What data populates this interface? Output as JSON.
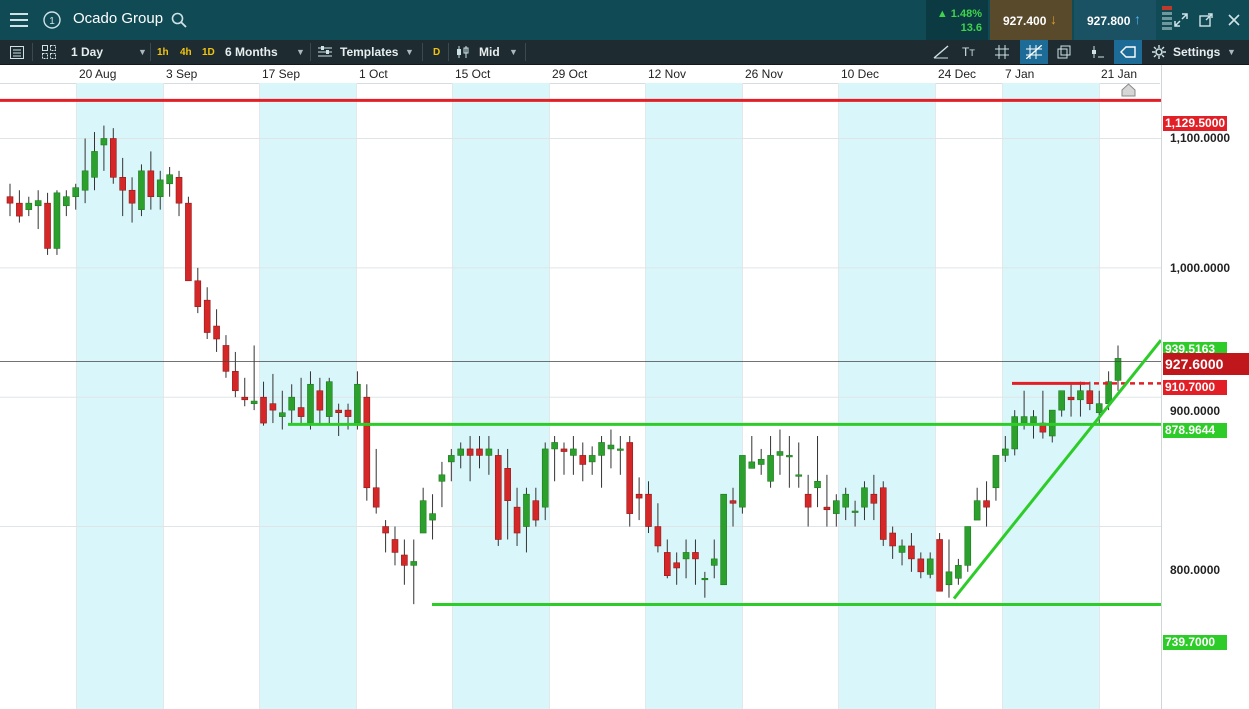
{
  "header": {
    "menu_icon": "hamburger-icon",
    "info_icon": "info-circle-icon",
    "title": "Ocado Group",
    "search_icon": "search-icon",
    "change_pct": "1.48%",
    "change_abs": "13.6",
    "sell_price": "927.400",
    "buy_price": "927.800",
    "colors": {
      "up": "#3fd44a",
      "bar": "#0f4a55"
    }
  },
  "toolbar": {
    "interval": "1 Day",
    "tf_1h": "1h",
    "tf_4h": "4h",
    "tf_1d": "1D",
    "range": "6 Months",
    "templates": "Templates",
    "d_badge": "D",
    "price_type": "Mid",
    "settings": "Settings"
  },
  "xaxis": {
    "labels": [
      "20 Aug",
      "3 Sep",
      "17 Sep",
      "1 Oct",
      "15 Oct",
      "29 Oct",
      "12 Nov",
      "26 Nov",
      "10 Dec",
      "24 Dec",
      "7 Jan",
      "21 Jan"
    ]
  },
  "yaxis": {
    "labels": [
      "1,100.0000",
      "1,000.0000",
      "900.0000",
      "800.0000"
    ]
  },
  "price_tags": {
    "resistance_red": "1,129.5000",
    "green_top": "939.5163",
    "current": "927.6000",
    "red_dashed": "910.7000",
    "support_mid": "878.9644",
    "support_low": "739.7000"
  },
  "chart_data": {
    "type": "candlestick",
    "ylim": [
      710,
      1160
    ],
    "x_labels": [
      "20 Aug",
      "3 Sep",
      "17 Sep",
      "1 Oct",
      "15 Oct",
      "29 Oct",
      "12 Nov",
      "26 Nov",
      "10 Dec",
      "24 Dec",
      "7 Jan",
      "21 Jan"
    ],
    "current_price": 927.6,
    "lines": [
      {
        "name": "resistance",
        "price": 1129.5,
        "color": "#e21f26"
      },
      {
        "name": "support-mid",
        "price": 878.9644,
        "color": "#2ecc29"
      },
      {
        "name": "support-low",
        "price": 739.7,
        "color": "#2ecc29"
      },
      {
        "name": "short-red",
        "price": 910.7,
        "color": "#e21f26"
      }
    ],
    "trendline": {
      "start": [
        "24 Dec",
        739.7
      ],
      "end": [
        "21 Jan",
        939.5163
      ],
      "color": "#2ecc29"
    },
    "candles": [
      [
        1055,
        1065,
        1040,
        1050
      ],
      [
        1050,
        1060,
        1035,
        1040
      ],
      [
        1045,
        1055,
        1040,
        1050
      ],
      [
        1048,
        1060,
        1030,
        1052
      ],
      [
        1050,
        1058,
        1010,
        1015
      ],
      [
        1015,
        1060,
        1010,
        1058
      ],
      [
        1048,
        1060,
        1040,
        1055
      ],
      [
        1055,
        1065,
        1045,
        1062
      ],
      [
        1060,
        1100,
        1050,
        1075
      ],
      [
        1070,
        1105,
        1060,
        1090
      ],
      [
        1095,
        1110,
        1075,
        1100
      ],
      [
        1100,
        1108,
        1065,
        1070
      ],
      [
        1070,
        1085,
        1040,
        1060
      ],
      [
        1060,
        1070,
        1035,
        1050
      ],
      [
        1045,
        1080,
        1040,
        1075
      ],
      [
        1075,
        1090,
        1045,
        1055
      ],
      [
        1055,
        1075,
        1045,
        1068
      ],
      [
        1065,
        1078,
        1055,
        1072
      ],
      [
        1070,
        1075,
        1040,
        1050
      ],
      [
        1050,
        1055,
        990,
        990
      ],
      [
        990,
        1000,
        965,
        970
      ],
      [
        975,
        985,
        945,
        950
      ],
      [
        955,
        968,
        935,
        945
      ],
      [
        940,
        948,
        915,
        920
      ],
      [
        920,
        935,
        900,
        905
      ],
      [
        900,
        915,
        893,
        898
      ],
      [
        895,
        940,
        890,
        897
      ],
      [
        900,
        912,
        878,
        880
      ],
      [
        895,
        918,
        880,
        890
      ],
      [
        885,
        905,
        875,
        888
      ],
      [
        890,
        910,
        880,
        900
      ],
      [
        892,
        915,
        878,
        885
      ],
      [
        880,
        920,
        875,
        910
      ],
      [
        905,
        915,
        878,
        890
      ],
      [
        885,
        915,
        880,
        912
      ],
      [
        890,
        895,
        870,
        888
      ],
      [
        890,
        895,
        875,
        885
      ],
      [
        880,
        920,
        875,
        910
      ],
      [
        900,
        910,
        820,
        830
      ],
      [
        830,
        860,
        810,
        815
      ],
      [
        800,
        805,
        780,
        795
      ],
      [
        790,
        800,
        770,
        780
      ],
      [
        778,
        790,
        755,
        770
      ],
      [
        770,
        790,
        740,
        773
      ],
      [
        795,
        830,
        795,
        820
      ],
      [
        805,
        825,
        790,
        810
      ],
      [
        835,
        850,
        815,
        840
      ],
      [
        850,
        860,
        835,
        855
      ],
      [
        855,
        865,
        845,
        860
      ],
      [
        860,
        870,
        835,
        855
      ],
      [
        860,
        870,
        845,
        855
      ],
      [
        855,
        870,
        840,
        860
      ],
      [
        855,
        860,
        785,
        790
      ],
      [
        845,
        860,
        790,
        820
      ],
      [
        815,
        830,
        785,
        795
      ],
      [
        800,
        830,
        780,
        825
      ],
      [
        820,
        830,
        800,
        805
      ],
      [
        815,
        865,
        805,
        860
      ],
      [
        860,
        870,
        835,
        865
      ],
      [
        860,
        865,
        840,
        858
      ],
      [
        855,
        870,
        840,
        860
      ],
      [
        855,
        865,
        835,
        848
      ],
      [
        850,
        862,
        840,
        855
      ],
      [
        855,
        870,
        830,
        865
      ],
      [
        860,
        875,
        845,
        863
      ],
      [
        860,
        870,
        840,
        860
      ],
      [
        865,
        870,
        800,
        810
      ],
      [
        825,
        838,
        805,
        822
      ],
      [
        825,
        835,
        795,
        800
      ],
      [
        800,
        818,
        780,
        785
      ],
      [
        780,
        790,
        760,
        762
      ],
      [
        772,
        780,
        755,
        768
      ],
      [
        775,
        790,
        760,
        780
      ],
      [
        780,
        790,
        755,
        775
      ],
      [
        760,
        765,
        745,
        760
      ],
      [
        770,
        790,
        760,
        775
      ],
      [
        755,
        815,
        755,
        825
      ],
      [
        820,
        830,
        800,
        818
      ],
      [
        815,
        855,
        810,
        855
      ],
      [
        845,
        870,
        845,
        850
      ],
      [
        848,
        860,
        840,
        852
      ],
      [
        835,
        870,
        830,
        855
      ],
      [
        855,
        875,
        840,
        858
      ],
      [
        855,
        870,
        830,
        855
      ],
      [
        840,
        865,
        830,
        840
      ],
      [
        825,
        840,
        800,
        815
      ],
      [
        830,
        870,
        815,
        835
      ],
      [
        815,
        840,
        800,
        813
      ],
      [
        810,
        825,
        800,
        820
      ],
      [
        815,
        830,
        805,
        825
      ],
      [
        812,
        820,
        800,
        812
      ],
      [
        815,
        835,
        805,
        830
      ],
      [
        825,
        840,
        805,
        818
      ],
      [
        830,
        835,
        785,
        790
      ],
      [
        795,
        800,
        775,
        785
      ],
      [
        780,
        790,
        770,
        785
      ],
      [
        785,
        795,
        765,
        775
      ],
      [
        775,
        780,
        760,
        765
      ],
      [
        763,
        780,
        760,
        775
      ],
      [
        790,
        795,
        750,
        750
      ],
      [
        755,
        790,
        745,
        765
      ],
      [
        760,
        775,
        755,
        770
      ],
      [
        770,
        800,
        765,
        800
      ],
      [
        805,
        830,
        805,
        820
      ],
      [
        820,
        835,
        800,
        815
      ],
      [
        830,
        855,
        820,
        855
      ],
      [
        855,
        870,
        850,
        860
      ],
      [
        860,
        890,
        855,
        885
      ],
      [
        880,
        905,
        875,
        885
      ],
      [
        880,
        890,
        868,
        885
      ],
      [
        880,
        905,
        868,
        873
      ],
      [
        870,
        890,
        865,
        890
      ],
      [
        890,
        905,
        885,
        905
      ],
      [
        900,
        910,
        885,
        898
      ],
      [
        898,
        912,
        885,
        905
      ],
      [
        905,
        912,
        890,
        895
      ],
      [
        888,
        905,
        880,
        895
      ],
      [
        895,
        920,
        890,
        912
      ],
      [
        913,
        940,
        905,
        930
      ]
    ]
  }
}
